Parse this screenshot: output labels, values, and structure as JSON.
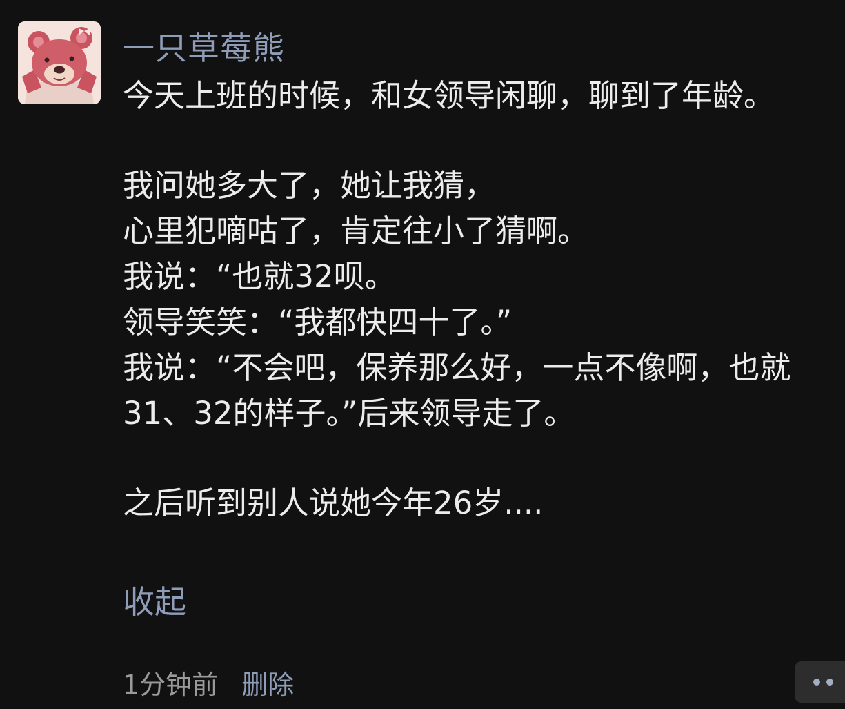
{
  "post": {
    "author": "一只草莓熊",
    "lines": [
      "今天上班的时候，和女领导闲聊，聊到了年龄。",
      "",
      "我问她多大了，她让我猜，",
      "心里犯嘀咕了，肯定往小了猜啊。",
      "我说：“也就32呗。",
      "领导笑笑：“我都快四十了。”",
      "我说：“不会吧，保养那么好，一点不像啊，也就31、32的样子。”后来领导走了。",
      "",
      "之后听到别人说她今年26岁...."
    ],
    "collapse_label": "收起",
    "time_ago": "1分钟前",
    "delete_label": "删除",
    "more_icon": "more-dots-icon"
  },
  "colors": {
    "background": "#111111",
    "text": "#ececec",
    "link": "#8f9db9",
    "meta": "#9a9a9a",
    "more_button_bg": "#2d2d2d"
  }
}
